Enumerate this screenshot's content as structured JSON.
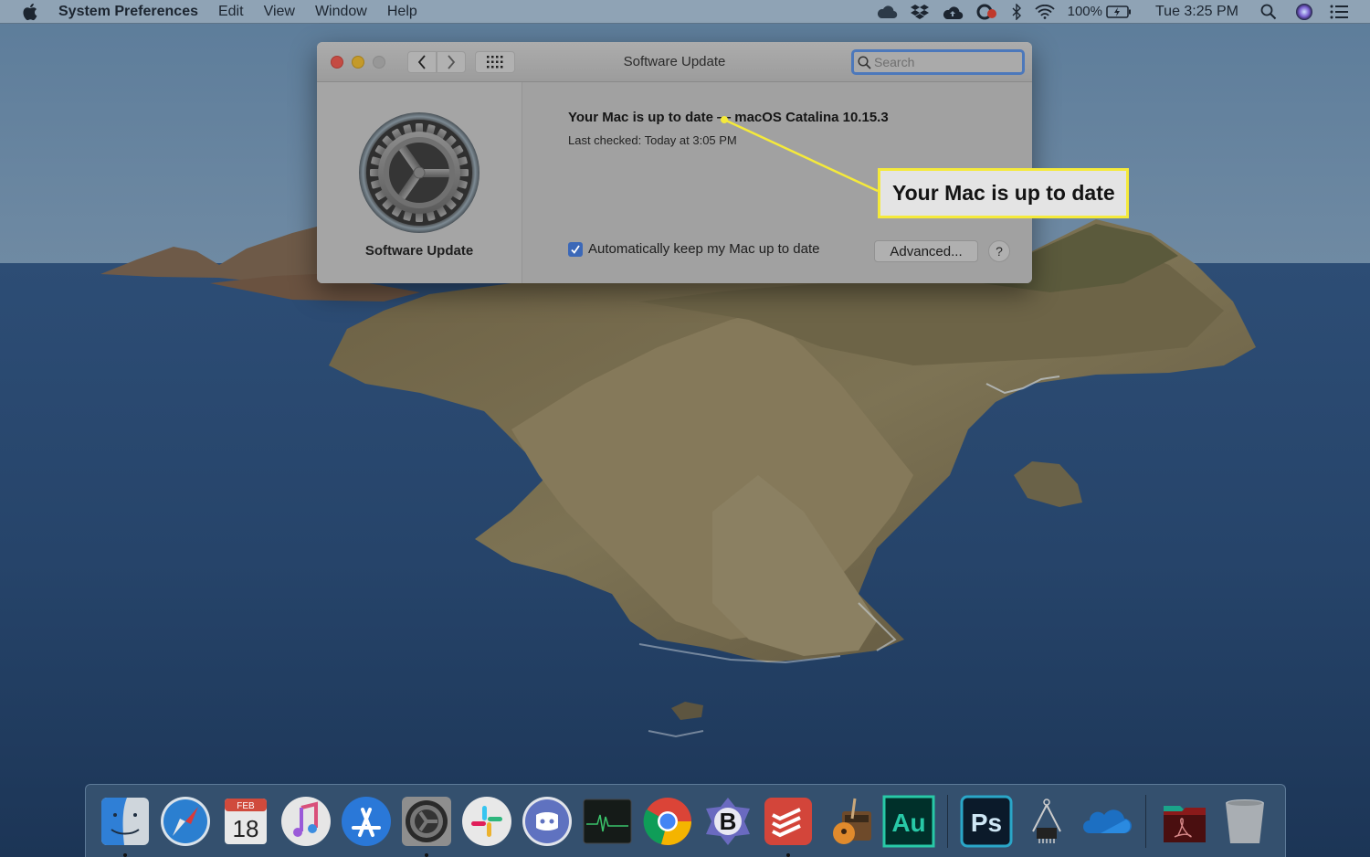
{
  "menubar": {
    "apple_icon": "apple-logo-icon",
    "app_name": "System Preferences",
    "menus": [
      "Edit",
      "View",
      "Window",
      "Help"
    ],
    "status_icons": [
      "icloud-icon",
      "dropbox-icon",
      "cloud-upload-icon",
      "creative-cloud-icon",
      "bluetooth-icon",
      "wifi-icon"
    ],
    "battery_percent": "100%",
    "battery_state": "charging",
    "clock": "Tue 3:25 PM",
    "right_icons": [
      "spotlight-search-icon",
      "siri-icon",
      "notification-center-icon"
    ]
  },
  "window": {
    "title": "Software Update",
    "search_placeholder": "Search",
    "sidebar_label": "Software Update",
    "status_title": "Your Mac is up to date — macOS Catalina 10.15.3",
    "last_checked": "Last checked: Today at 3:05 PM",
    "auto_update_label": "Automatically keep my Mac up to date",
    "auto_update_checked": true,
    "advanced_button": "Advanced...",
    "help_button": "?"
  },
  "annotation": {
    "text": "Your Mac is up to date",
    "color": "#f5ea3a"
  },
  "dock": {
    "apps": [
      {
        "name": "Finder",
        "icon": "finder-icon",
        "running": true
      },
      {
        "name": "Safari",
        "icon": "safari-icon",
        "running": false
      },
      {
        "name": "Calendar",
        "icon": "calendar-icon",
        "running": false,
        "month": "FEB",
        "day": "18"
      },
      {
        "name": "Music",
        "icon": "music-icon",
        "running": false
      },
      {
        "name": "App Store",
        "icon": "app-store-icon",
        "running": false
      },
      {
        "name": "System Preferences",
        "icon": "system-preferences-icon",
        "running": true
      },
      {
        "name": "Slack",
        "icon": "slack-icon",
        "running": false
      },
      {
        "name": "Discord",
        "icon": "discord-icon",
        "running": false
      },
      {
        "name": "Activity Monitor",
        "icon": "activity-monitor-icon",
        "running": false
      },
      {
        "name": "Chrome",
        "icon": "chrome-icon",
        "running": false
      },
      {
        "name": "BBEdit",
        "icon": "bbedit-icon",
        "running": false,
        "letter": "B"
      },
      {
        "name": "Todoist",
        "icon": "todoist-icon",
        "running": true
      },
      {
        "name": "GarageBand",
        "icon": "garageband-icon",
        "running": false
      },
      {
        "name": "Audition",
        "icon": "audition-icon",
        "running": false,
        "letter": "Au"
      },
      {
        "name": "Photoshop",
        "icon": "photoshop-icon",
        "running": false,
        "letter": "Ps"
      },
      {
        "name": "System Information",
        "icon": "system-information-icon",
        "running": false
      },
      {
        "name": "OneDrive",
        "icon": "onedrive-icon",
        "running": false
      },
      {
        "name": "PDF Folder",
        "icon": "pdf-folder-icon",
        "running": false
      },
      {
        "name": "Trash",
        "icon": "trash-icon",
        "running": false
      }
    ]
  }
}
